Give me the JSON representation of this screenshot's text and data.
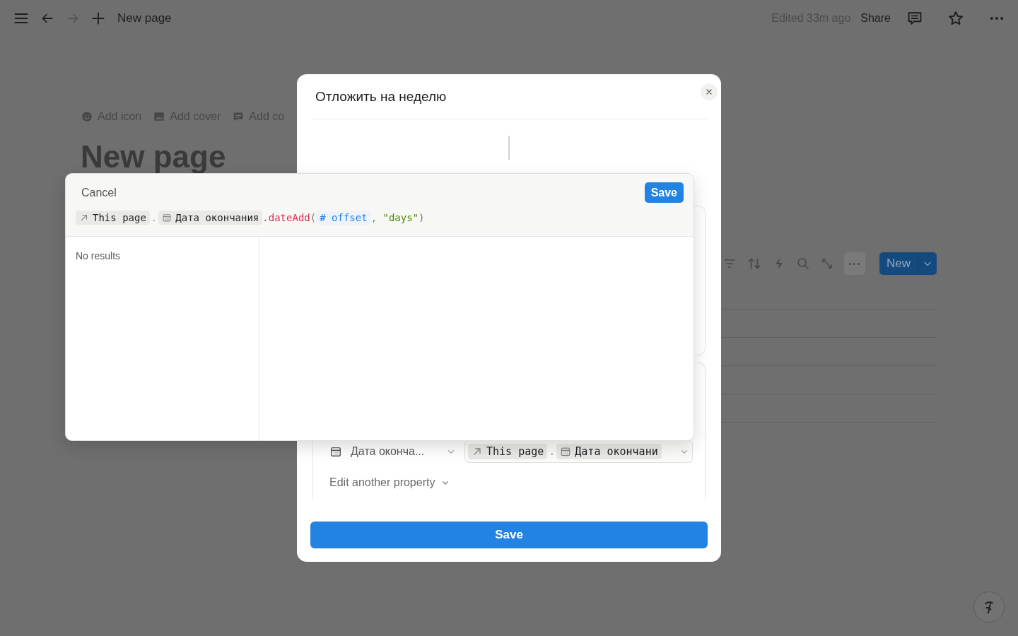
{
  "top_bar": {
    "title": "New page",
    "edited": "Edited 33m ago",
    "share": "Share"
  },
  "page": {
    "actions": [
      {
        "kind": "icon",
        "label": "Add icon"
      },
      {
        "kind": "cover",
        "label": "Add cover"
      },
      {
        "kind": "comment",
        "label": "Add co"
      }
    ],
    "title": "New page"
  },
  "database_toolbar": {
    "new_button": "New"
  },
  "modal": {
    "title": "Отложить на неделю",
    "property_row": {
      "label": "Дата оконча...",
      "tokens": [
        {
          "kind": "page",
          "text": "This page"
        },
        {
          "kind": "dot",
          "text": "."
        },
        {
          "kind": "date",
          "text": "Дата окончани"
        }
      ]
    },
    "edit_another": "Edit another property",
    "save": "Save"
  },
  "formula_editor": {
    "cancel": "Cancel",
    "save": "Save",
    "tokens": [
      {
        "kind": "page",
        "text": "This page"
      },
      {
        "kind": "dot",
        "text": "."
      },
      {
        "kind": "date",
        "text": "Дата окончания"
      },
      {
        "kind": "function",
        "text": ".dateAdd"
      },
      {
        "kind": "punct",
        "text": "("
      },
      {
        "kind": "variable",
        "text": "# offset"
      },
      {
        "kind": "punct",
        "text": ", "
      },
      {
        "kind": "string",
        "text": "\"days\""
      },
      {
        "kind": "punct",
        "text": ")"
      }
    ],
    "results": "No results"
  }
}
